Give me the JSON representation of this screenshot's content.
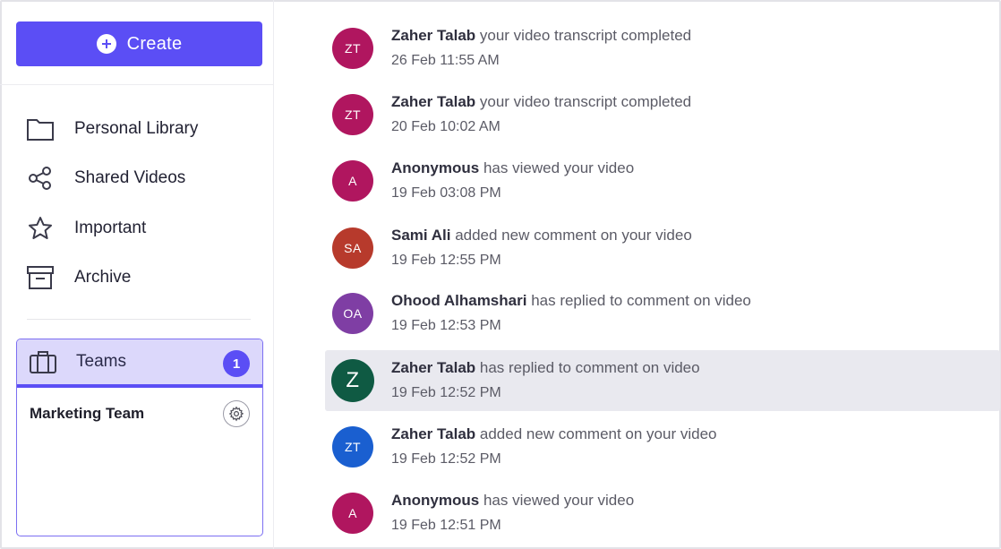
{
  "sidebar": {
    "create_label": "Create",
    "nav": [
      {
        "label": "Personal Library",
        "icon": "folder-icon"
      },
      {
        "label": "Shared Videos",
        "icon": "share-icon"
      },
      {
        "label": "Important",
        "icon": "star-icon"
      },
      {
        "label": "Archive",
        "icon": "archive-icon"
      }
    ],
    "teams": {
      "label": "Teams",
      "badge": "1",
      "icon": "briefcase-icon",
      "team_name": "Marketing Team",
      "settings_icon": "gear-icon"
    }
  },
  "colors": {
    "accent": "#5b4ef5",
    "teams_bg": "#dcd8fb",
    "highlight_row": "#e9e9ef"
  },
  "notifications": [
    {
      "initials": "ZT",
      "name": "Zaher Talab",
      "action": "your video transcript completed",
      "time": "26 Feb 11:55 AM",
      "color": "#b0165f"
    },
    {
      "initials": "ZT",
      "name": "Zaher Talab",
      "action": "your video transcript completed",
      "time": "20 Feb 10:02 AM",
      "color": "#b0165f"
    },
    {
      "initials": "A",
      "name": "Anonymous",
      "action": "has viewed your video",
      "time": "19 Feb 03:08 PM",
      "color": "#b0165f"
    },
    {
      "initials": "SA",
      "name": "Sami Ali",
      "action": "added new comment on your video",
      "time": "19 Feb 12:55 PM",
      "color": "#b73a2c"
    },
    {
      "initials": "OA",
      "name": "Ohood Alhamshari",
      "action": "has replied to comment on video",
      "time": "19 Feb 12:53 PM",
      "color": "#7f3ea4"
    },
    {
      "initials": "Z",
      "name": "Zaher Talab",
      "action": "has replied to comment on video",
      "time": "19 Feb 12:52 PM",
      "color": "#0f5a43",
      "highlighted": true
    },
    {
      "initials": "ZT",
      "name": "Zaher Talab",
      "action": "added new comment on your video",
      "time": "19 Feb 12:52 PM",
      "color": "#1a5fd0"
    },
    {
      "initials": "A",
      "name": "Anonymous",
      "action": "has viewed your video",
      "time": "19 Feb 12:51 PM",
      "color": "#b0165f"
    }
  ]
}
